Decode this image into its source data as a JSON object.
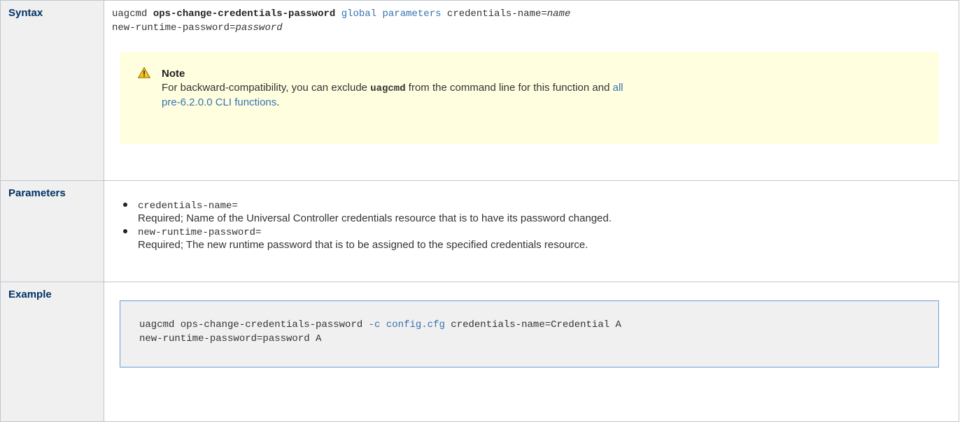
{
  "rows": {
    "syntax": {
      "label": "Syntax",
      "cmd": "uagcmd",
      "command": "ops-change-credentials-password",
      "global_params_link": "global parameters",
      "arg1_key": "credentials-name=",
      "arg1_val": "name",
      "arg2_key": "new-runtime-password=",
      "arg2_val": "password",
      "note": {
        "title": "Note",
        "text_before": "For backward-compatibility, you can exclude",
        "code": "uagcmd",
        "text_after": "from the command line for this function and",
        "link_line1": "all",
        "link_line2": "pre-6.2.0.0 CLI functions",
        "period": "."
      }
    },
    "parameters": {
      "label": "Parameters",
      "items": [
        {
          "name": "credentials-name=",
          "desc": "Required; Name of the Universal Controller credentials resource that is to have its password changed."
        },
        {
          "name": "new-runtime-password=",
          "desc": "Required; The new runtime password that is to be assigned to the specified credentials resource."
        }
      ]
    },
    "example": {
      "label": "Example",
      "line1_a": "uagcmd ops-change-credentials-password ",
      "line1_flag": "-c",
      "line1_file": "config.cfg",
      "line1_b": " credentials-name=Credential A",
      "line2": "new-runtime-password=password A"
    }
  },
  "colors": {
    "link": "#3572b0",
    "header_bg": "#f0f0f0",
    "note_bg": "#ffffe0",
    "warning_icon": "#f5c518"
  },
  "icons": {
    "note_icon": "warning-icon"
  }
}
